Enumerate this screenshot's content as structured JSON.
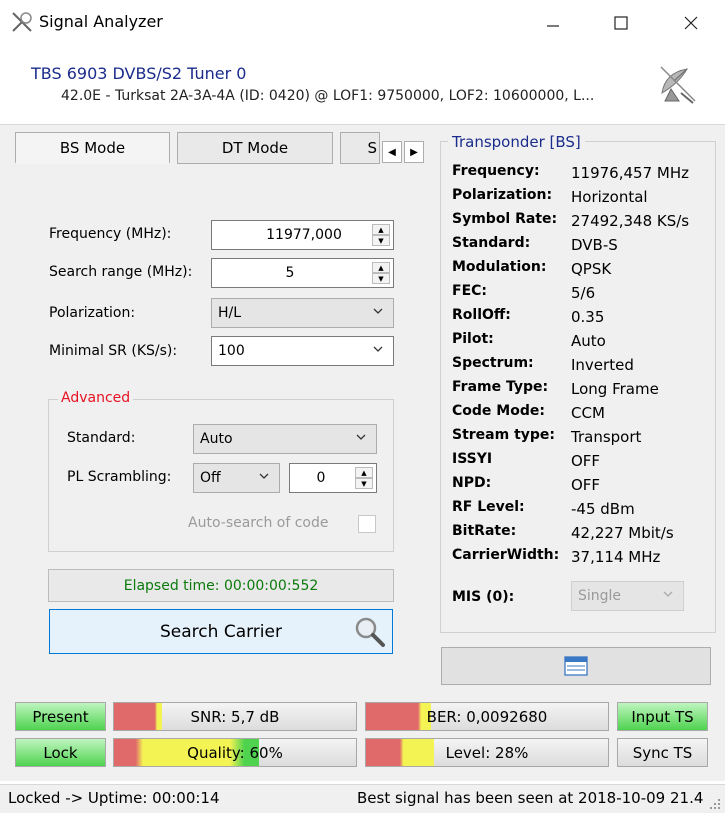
{
  "window": {
    "title": "Signal Analyzer",
    "minimize_icon": "minimize-icon",
    "maximize_icon": "maximize-icon",
    "close_icon": "close-icon"
  },
  "header": {
    "tuner_name": "TBS 6903 DVBS/S2 Tuner 0",
    "tuner_info": "42.0E - Turksat 2A-3A-4A (ID: 0420) @ LOF1: 9750000, LOF2: 10600000, L...",
    "icon": "satellite-dish-icon"
  },
  "tabs": [
    "BS Mode",
    "DT Mode",
    "S"
  ],
  "form": {
    "frequency_label": "Frequency (MHz):",
    "frequency_value": "11977,000",
    "search_range_label": "Search range (MHz):",
    "search_range_value": "5",
    "polarization_label": "Polarization:",
    "polarization_value": "H/L",
    "minimal_sr_label": "Minimal SR (KS/s):",
    "minimal_sr_value": "100"
  },
  "advanced": {
    "title": "Advanced",
    "standard_label": "Standard:",
    "standard_value": "Auto",
    "pl_scrambling_label": "PL Scrambling:",
    "pl_scrambling_value": "Off",
    "pl_code_value": "0",
    "auto_search_label": "Auto-search of code"
  },
  "elapsed": "Elapsed time: 00:00:00:552",
  "search_button": "Search Carrier",
  "transponder": {
    "title": "Transponder [BS]",
    "rows": [
      {
        "key": "Frequency:",
        "value": "11976,457 MHz"
      },
      {
        "key": "Polarization:",
        "value": "Horizontal"
      },
      {
        "key": "Symbol Rate:",
        "value": "27492,348 KS/s"
      },
      {
        "key": "Standard:",
        "value": "DVB-S"
      },
      {
        "key": "Modulation:",
        "value": "QPSK"
      },
      {
        "key": "FEC:",
        "value": "5/6"
      },
      {
        "key": "RollOff:",
        "value": "0.35"
      },
      {
        "key": "Pilot:",
        "value": "Auto"
      },
      {
        "key": "Spectrum:",
        "value": "Inverted"
      },
      {
        "key": "Frame Type:",
        "value": "Long Frame"
      },
      {
        "key": "Code Mode:",
        "value": "CCM"
      },
      {
        "key": "Stream type:",
        "value": "Transport"
      },
      {
        "key": "ISSYI",
        "value": "OFF"
      },
      {
        "key": "NPD:",
        "value": "OFF"
      },
      {
        "key": "RF Level:",
        "value": "-45 dBm"
      },
      {
        "key": "BitRate:",
        "value": "42,227 Mbit/s"
      },
      {
        "key": "CarrierWidth:",
        "value": "37,114 MHz"
      }
    ],
    "mis_label": "MIS (0):",
    "mis_value": "Single"
  },
  "indicators": {
    "present": "Present",
    "lock": "Lock",
    "snr": "SNR: 5,7 dB",
    "snr_level": 0.2,
    "quality": "Quality: 60%",
    "quality_level": 0.6,
    "ber": "BER: 0,0092680",
    "ber_level": 0.27,
    "level": "Level: 28%",
    "level_level": 0.28,
    "input_ts": "Input TS",
    "sync_ts": "Sync TS",
    "green_color": "#4fd34f",
    "red_color": "#e06a6a",
    "yellow_color": "#f3f354"
  },
  "status": {
    "left": "Locked -> Uptime: 00:00:14",
    "right": "Best signal has been seen at 2018-10-09 21.4"
  }
}
